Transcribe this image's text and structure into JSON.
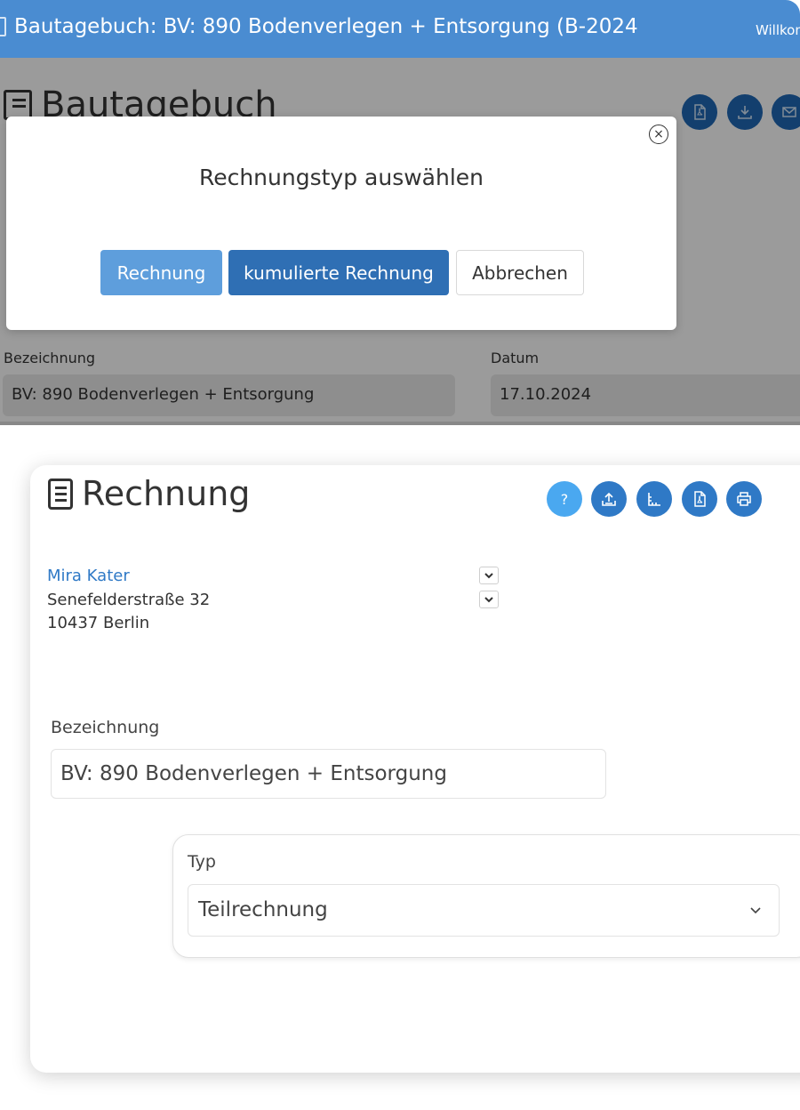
{
  "background_app": {
    "window_title": "Bautagebuch: BV: 890 Bodenverlegen + Entsorgung (B-2024",
    "welcome_text": "Willkom",
    "page_heading": "Bautagebuch",
    "header_icons": [
      "pdf-icon",
      "download-icon",
      "mail-icon"
    ],
    "fields": {
      "bezeichnung_label": "Bezeichnung",
      "bezeichnung_value": "BV: 890 Bodenverlegen + Entsorgung",
      "datum_label": "Datum",
      "datum_value": "17.10.2024"
    }
  },
  "dialog": {
    "title": "Rechnungstyp auswählen",
    "close_icon": "close-circle-icon",
    "buttons": {
      "rechnung": "Rechnung",
      "kumuliert": "kumulierte Rechnung",
      "abbrechen": "Abbrechen"
    }
  },
  "rechnung_card": {
    "heading": "Rechnung",
    "help_label": "?",
    "toolbar_icons": [
      "upload-icon",
      "ruler-icon",
      "pdf-icon",
      "print-icon"
    ],
    "client": {
      "name": "Mira Kater",
      "street": "Senefelderstraße 32",
      "city": "10437 Berlin"
    },
    "bezeichnung_label": "Bezeichnung",
    "bezeichnung_value": "BV: 890 Bodenverlegen + Entsorgung",
    "typ_label": "Typ",
    "typ_value": "Teilrechnung"
  },
  "colors": {
    "appbar": "#4a8cd1",
    "primary_dark": "#2f6fb4",
    "primary_light": "#5e9edc",
    "icon_button": "#2f79c6",
    "help_button": "#4aa8f0",
    "link": "#2f79c6"
  }
}
